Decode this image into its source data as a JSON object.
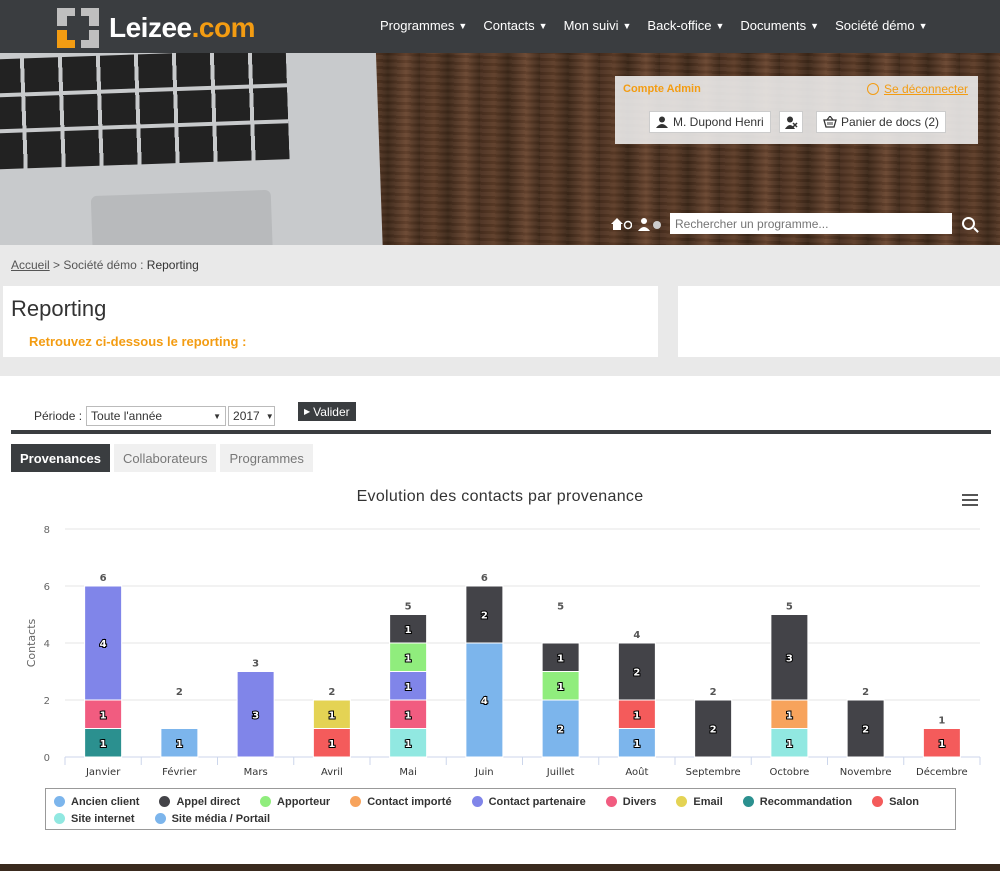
{
  "brand": {
    "name": "Leizee",
    "tld": ".com"
  },
  "nav": [
    {
      "label": "Programmes"
    },
    {
      "label": "Contacts"
    },
    {
      "label": "Mon suivi"
    },
    {
      "label": "Back-office"
    },
    {
      "label": "Documents"
    },
    {
      "label": "Société démo"
    }
  ],
  "account": {
    "title": "Compte Admin",
    "logout": "Se déconnecter",
    "user": "M. Dupond Henri",
    "cart": "Panier de docs (2)"
  },
  "search": {
    "placeholder": "Rechercher un programme..."
  },
  "breadcrumb": {
    "home": "Accueil",
    "company": "Société démo",
    "current": "Reporting"
  },
  "page": {
    "title": "Reporting",
    "subtitle": "Retrouvez ci-dessous le reporting :"
  },
  "filters": {
    "label": "Période :",
    "period": "Toute l'année",
    "year": "2017",
    "submit": "Valider"
  },
  "tabs": [
    {
      "label": "Provenances",
      "active": true
    },
    {
      "label": "Collaborateurs",
      "active": false
    },
    {
      "label": "Programmes",
      "active": false
    }
  ],
  "chart_data": {
    "type": "bar",
    "stacked": true,
    "title": "Evolution des contacts par provenance",
    "ylabel": "Contacts",
    "xlabel": "",
    "ylim": [
      0,
      8
    ],
    "yticks": [
      0,
      2,
      4,
      6,
      8
    ],
    "grid": true,
    "legend_position": "bottom",
    "categories": [
      "Janvier",
      "Février",
      "Mars",
      "Avril",
      "Mai",
      "Juin",
      "Juillet",
      "Août",
      "Septembre",
      "Octobre",
      "Novembre",
      "Décembre"
    ],
    "totals": [
      6,
      2,
      3,
      2,
      5,
      6,
      5,
      4,
      2,
      5,
      2,
      1
    ],
    "series": [
      {
        "name": "Ancien client",
        "color": "#7cb5ec",
        "values": [
          0,
          0,
          0,
          0,
          0,
          0,
          0,
          0,
          0,
          0,
          0,
          0
        ]
      },
      {
        "name": "Appel direct",
        "color": "#434348",
        "values": [
          0,
          0,
          0,
          0,
          1,
          2,
          1,
          2,
          2,
          3,
          2,
          0
        ]
      },
      {
        "name": "Apporteur",
        "color": "#90ed7d",
        "values": [
          0,
          0,
          0,
          0,
          1,
          0,
          1,
          0,
          0,
          0,
          0,
          0
        ]
      },
      {
        "name": "Contact importé",
        "color": "#f7a35c",
        "values": [
          0,
          0,
          0,
          0,
          0,
          0,
          0,
          0,
          0,
          1,
          0,
          0
        ]
      },
      {
        "name": "Contact partenaire",
        "color": "#8085e9",
        "values": [
          4,
          0,
          3,
          0,
          1,
          0,
          0,
          0,
          0,
          0,
          0,
          0
        ]
      },
      {
        "name": "Divers",
        "color": "#f15c80",
        "values": [
          1,
          0,
          0,
          0,
          1,
          0,
          0,
          0,
          0,
          0,
          0,
          0
        ]
      },
      {
        "name": "Email",
        "color": "#e4d354",
        "values": [
          0,
          0,
          0,
          1,
          0,
          0,
          0,
          0,
          0,
          0,
          0,
          0
        ]
      },
      {
        "name": "Recommandation",
        "color": "#2b908f",
        "values": [
          1,
          0,
          0,
          0,
          0,
          0,
          0,
          0,
          0,
          0,
          0,
          0
        ]
      },
      {
        "name": "Salon",
        "color": "#f45b5b",
        "values": [
          0,
          0,
          0,
          1,
          0,
          0,
          0,
          1,
          0,
          0,
          0,
          1
        ]
      },
      {
        "name": "Site internet",
        "color": "#91e8e1",
        "values": [
          0,
          0,
          0,
          0,
          1,
          0,
          0,
          0,
          0,
          1,
          0,
          0
        ]
      },
      {
        "name": "Site média / Portail",
        "color": "#7cb5ec",
        "values": [
          0,
          1,
          0,
          0,
          0,
          4,
          2,
          1,
          0,
          0,
          0,
          0
        ]
      }
    ]
  }
}
